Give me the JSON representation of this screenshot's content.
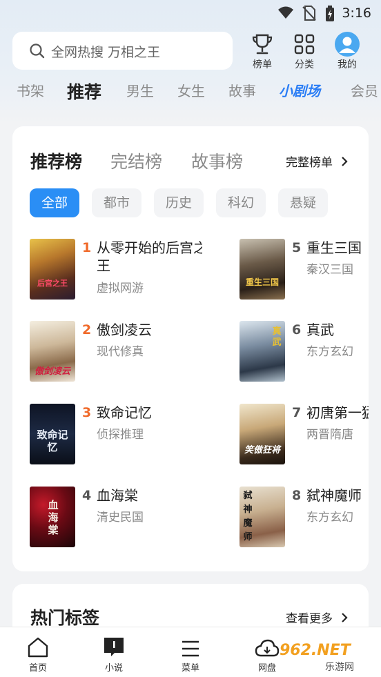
{
  "status_bar": {
    "time": "3:16"
  },
  "search": {
    "placeholder": "全网热搜 万相之王"
  },
  "top_icons": [
    {
      "label": "榜单",
      "icon": "trophy-icon"
    },
    {
      "label": "分类",
      "icon": "grid-icon"
    },
    {
      "label": "我的",
      "icon": "avatar-icon"
    }
  ],
  "nav_tabs": [
    "书架",
    "推荐",
    "男生",
    "女生",
    "故事",
    "小剧场",
    "会员"
  ],
  "active_nav_tab": "推荐",
  "rank_card": {
    "tabs": [
      "推荐榜",
      "完结榜",
      "故事榜"
    ],
    "full_list_label": "完整榜单",
    "chips": [
      "全部",
      "都市",
      "历史",
      "科幻",
      "悬疑"
    ],
    "books": [
      {
        "rank": "1",
        "title": "从零开始的后宫之王",
        "category": "虚拟网游"
      },
      {
        "rank": "2",
        "title": "傲剑凌云",
        "category": "现代修真"
      },
      {
        "rank": "3",
        "title": "致命记忆",
        "category": "侦探推理"
      },
      {
        "rank": "4",
        "title": "血海棠",
        "category": "清史民国"
      },
      {
        "rank": "5",
        "title": "重生三国",
        "category": "秦汉三国"
      },
      {
        "rank": "6",
        "title": "真武",
        "category": "东方玄幻"
      },
      {
        "rank": "7",
        "title": "初唐第一猛",
        "category": "两晋隋唐"
      },
      {
        "rank": "8",
        "title": "弑神魔师",
        "category": "东方玄幻"
      }
    ],
    "cover_texts": [
      "后宫之王",
      "傲剑凌云",
      "致命记忆",
      "血海棠",
      "重生三国",
      "真武",
      "笑傲狂将",
      "弑神魔师"
    ],
    "colors": {
      "top_rank": "#f06a2a",
      "normal_rank": "#555555",
      "accent": "#2a8ef5"
    }
  },
  "hot_tags": {
    "title": "热门标签",
    "more_label": "查看更多"
  },
  "bottom_nav": [
    {
      "label": "首页",
      "icon": "home-icon"
    },
    {
      "label": "小说",
      "icon": "novel-icon"
    },
    {
      "label": "菜单",
      "icon": "menu-icon"
    },
    {
      "label": "网盘",
      "icon": "cloud-icon"
    }
  ],
  "watermark": {
    "brand": "962.NET",
    "sub": "乐游网"
  }
}
